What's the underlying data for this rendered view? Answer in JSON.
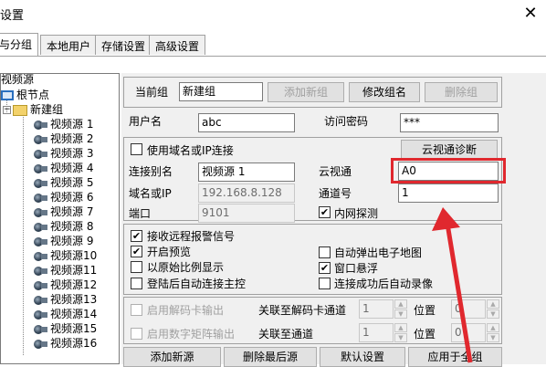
{
  "window": {
    "title": "设置",
    "close_glyph": "✕"
  },
  "tabs": [
    "与分组",
    "本地用户",
    "存储设置",
    "高级设置"
  ],
  "tree": {
    "header": "视频源",
    "root": "根节点",
    "group": "新建组",
    "items": [
      "视频源 1",
      "视频源 2",
      "视频源 3",
      "视频源 4",
      "视频源 5",
      "视频源 6",
      "视频源 7",
      "视频源 8",
      "视频源 9",
      "视频源10",
      "视频源11",
      "视频源12",
      "视频源13",
      "视频源14",
      "视频源15",
      "视频源16"
    ]
  },
  "group_bar": {
    "current_label": "当前组",
    "current_value": "新建组",
    "add_group": "添加新组",
    "rename_group": "修改组名",
    "delete_group": "删除组"
  },
  "user": {
    "username_label": "用户名",
    "username_value": "abc",
    "password_label": "访问密码",
    "password_value": "***"
  },
  "connection": {
    "use_domain_label": "使用域名或IP连接",
    "use_domain_checked": false,
    "cloud_diag": "云视通诊断",
    "alias_label": "连接别名",
    "alias_value": "视频源 1",
    "cloud_label": "云视通",
    "cloud_value": "A0",
    "host_label": "域名或IP",
    "host_value": "192.168.8.128",
    "channel_label": "通道号",
    "channel_value": "1",
    "port_label": "端口",
    "port_value": "9101",
    "lan_probe_label": "内网探测",
    "lan_probe_checked": true
  },
  "options": {
    "receive_alarm": "接收远程报警信号",
    "start_preview": "开启预览",
    "auto_popup_map": "自动弹出电子地图",
    "original_ratio": "以原始比例显示",
    "window_float": "窗口悬浮",
    "auto_connect_main": "登陆后自动连接主控",
    "auto_record": "连接成功后自动录像",
    "check_glyph": "✔"
  },
  "decode": {
    "decode_output": "启用解码卡输出",
    "link_decode_channel": "关联至解码卡通道",
    "decode_channel_value": "1",
    "position_label": "位置",
    "position_value": "0",
    "matrix_output": "启用数字矩阵输出",
    "link_channel": "关联至通道",
    "matrix_channel_value": "1",
    "position_label2": "位置",
    "position_value2": "0"
  },
  "bottom_buttons": [
    "添加新源",
    "删除最后源",
    "默认设置",
    "应用于全组"
  ],
  "colors": {
    "annotation_red": "#e0282e",
    "panel_bg": "#f0f0f0"
  }
}
